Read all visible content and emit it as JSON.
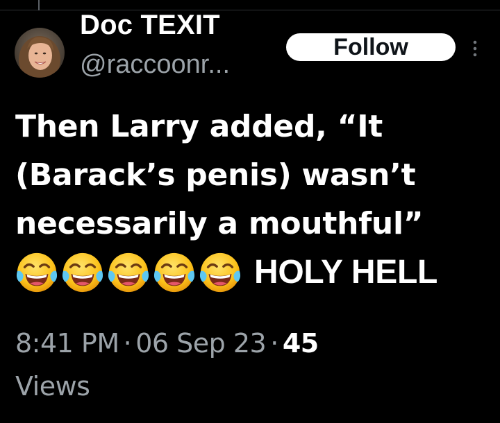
{
  "author": {
    "display_name": "Doc TEXIT",
    "handle": "@raccoonr..."
  },
  "actions": {
    "follow_label": "Follow",
    "more_icon": "more-vertical-icon"
  },
  "tweet": {
    "lines": [
      "Then Larry added, “It",
      "(Barack’s penis) wasn’t",
      "necessarily a mouthful”"
    ],
    "emoji": {
      "name": "face-with-tears-of-joy-icon",
      "count": 5
    },
    "trailing_text": "HOLY HELL"
  },
  "meta": {
    "time": "8:41 PM",
    "separator": "·",
    "date": "06 Sep 23",
    "views_count": "45",
    "views_label": "Views"
  },
  "colors": {
    "background": "#000000",
    "text": "#ffffff",
    "secondary_text": "#9ca3a9",
    "follow_bg": "#ffffff",
    "follow_text": "#0f1419"
  }
}
